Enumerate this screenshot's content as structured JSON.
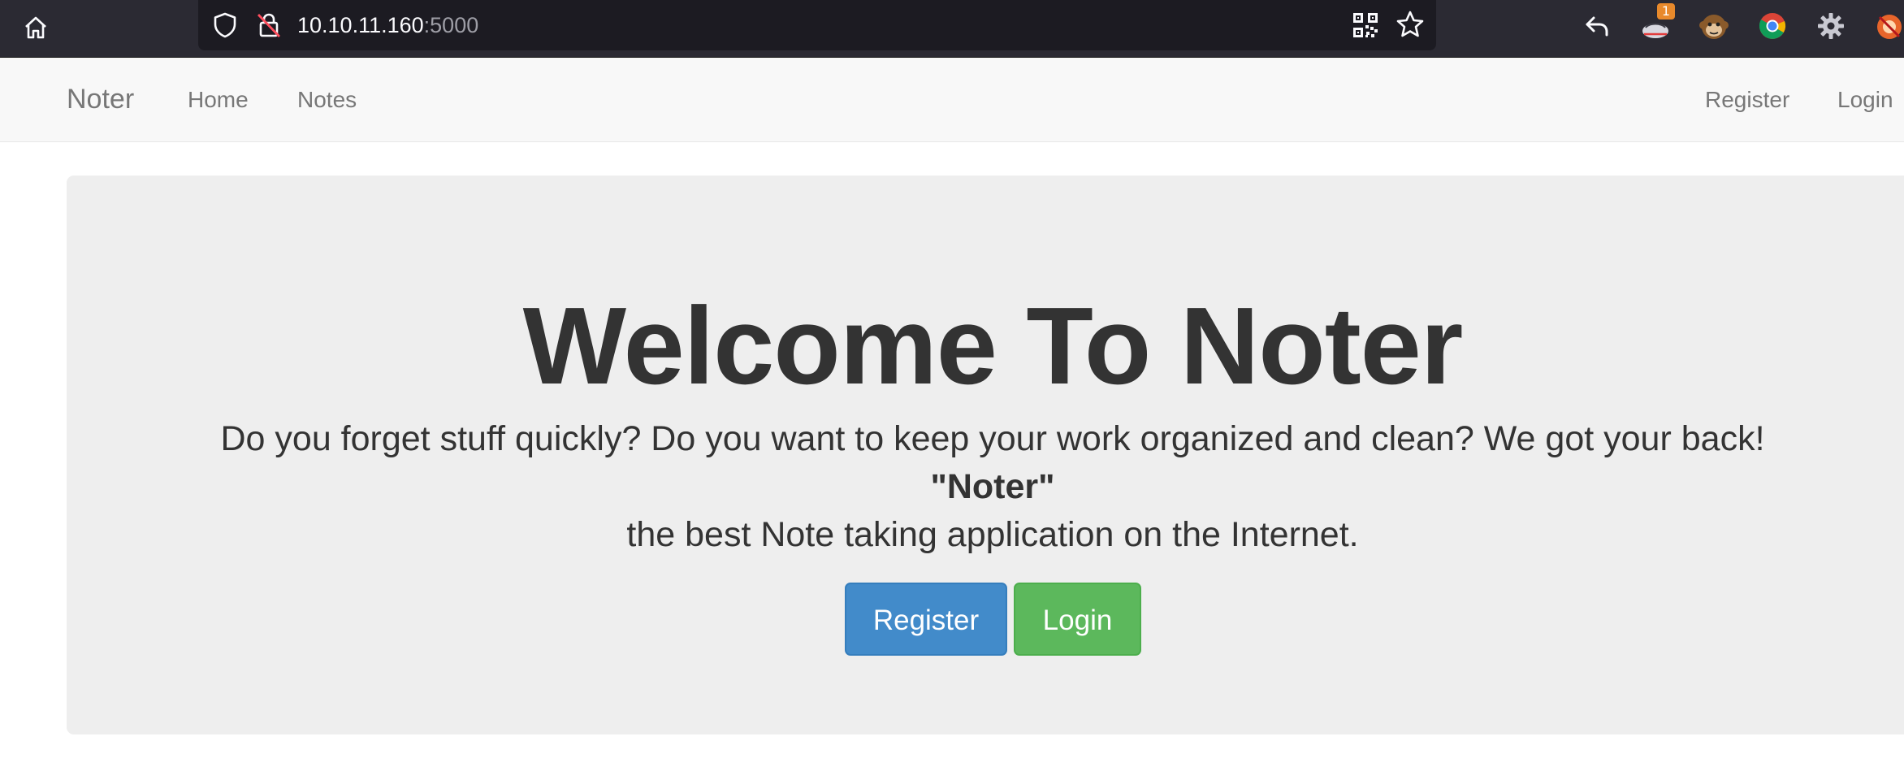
{
  "browser": {
    "url_host": "10.10.11.160",
    "url_port": ":5000",
    "extension_badge": "1",
    "icons": [
      "home-icon",
      "shield-icon",
      "lock-insecure-icon",
      "qr-code-icon",
      "bookmark-star-icon",
      "back-arrow-icon",
      "extension-icon",
      "monkey-extension-icon",
      "chrome-extension-icon",
      "gear-icon",
      "fox-extension-icon"
    ]
  },
  "navbar": {
    "brand": "Noter",
    "home": "Home",
    "notes": "Notes",
    "register": "Register",
    "login": "Login"
  },
  "jumbotron": {
    "title": "Welcome To Noter",
    "line1": "Do you forget stuff quickly? Do you want to keep your work organized and clean? We got your back!",
    "line2": "\"Noter\"",
    "line3": "the best Note taking application on the Internet.",
    "register_button": "Register",
    "login_button": "Login"
  },
  "colors": {
    "chrome_bg": "#2b2a33",
    "urlbar_bg": "#1c1b22",
    "navbar_bg": "#f8f8f8",
    "jumbotron_bg": "#eeeeee",
    "register_btn": "#428bca",
    "login_btn": "#5cb85c"
  }
}
